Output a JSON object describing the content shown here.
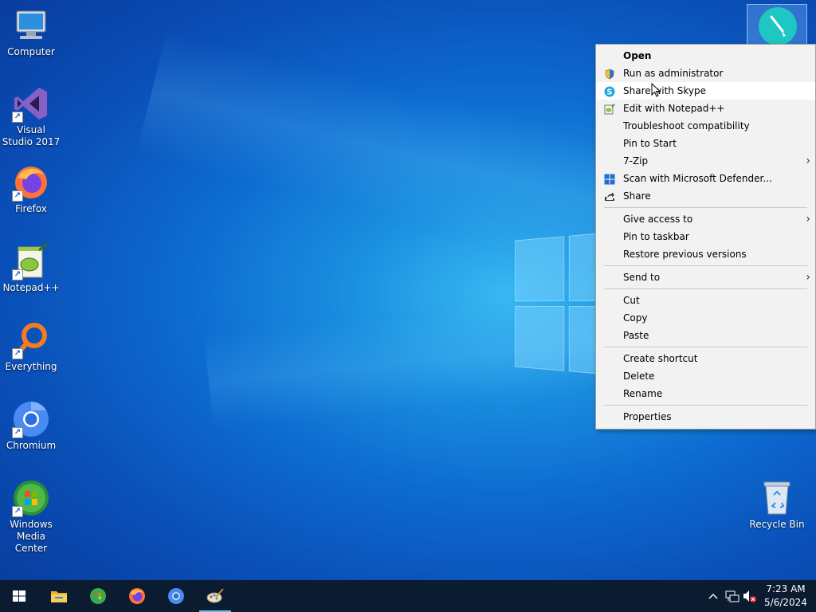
{
  "desktop_icons": [
    {
      "label": "Computer"
    },
    {
      "label": "Visual Studio 2017"
    },
    {
      "label": "Firefox"
    },
    {
      "label": "Notepad++"
    },
    {
      "label": "Everything"
    },
    {
      "label": "Chromium"
    },
    {
      "label": "Windows Media Center"
    },
    {
      "label": "Recycle Bin"
    }
  ],
  "context_menu": {
    "items": [
      {
        "label": "Open"
      },
      {
        "label": "Run as administrator"
      },
      {
        "label": "Share with Skype"
      },
      {
        "label": "Edit with Notepad++"
      },
      {
        "label": "Troubleshoot compatibility"
      },
      {
        "label": "Pin to Start"
      },
      {
        "label": "7-Zip"
      },
      {
        "label": "Scan with Microsoft Defender..."
      },
      {
        "label": "Share"
      },
      {
        "label": "Give access to"
      },
      {
        "label": "Pin to taskbar"
      },
      {
        "label": "Restore previous versions"
      },
      {
        "label": "Send to"
      },
      {
        "label": "Cut"
      },
      {
        "label": "Copy"
      },
      {
        "label": "Paste"
      },
      {
        "label": "Create shortcut"
      },
      {
        "label": "Delete"
      },
      {
        "label": "Rename"
      },
      {
        "label": "Properties"
      }
    ]
  },
  "taskbar": {
    "clock_time": "7:23 AM",
    "clock_date": "5/6/2024",
    "pinned": [
      "file-explorer-icon",
      "windows-media-center-icon",
      "firefox-icon",
      "chromium-icon",
      "paint-icon"
    ]
  },
  "colors": {
    "taskbar": "#0c1c30",
    "menu_bg": "#f2f2f2",
    "accent": "#76b9ed"
  }
}
